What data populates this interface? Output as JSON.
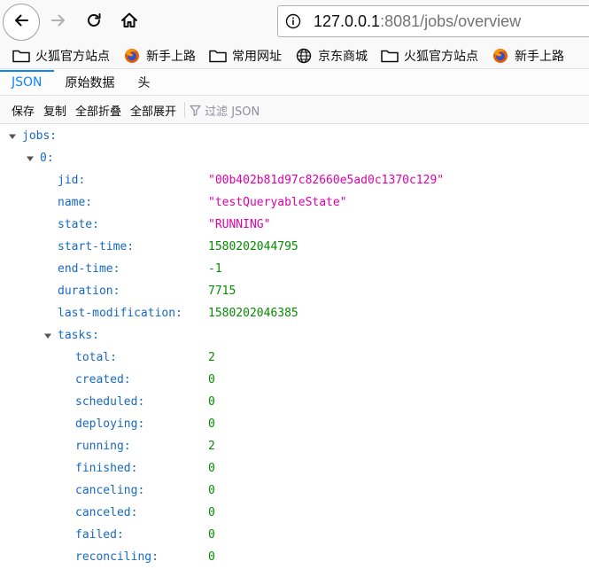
{
  "nav": {
    "url_host": "127.0.0.1",
    "url_rest": ":8081/jobs/overview"
  },
  "bookmarks": [
    {
      "label": "火狐官方站点",
      "icon": "folder-icon"
    },
    {
      "label": "新手上路",
      "icon": "firefox-icon"
    },
    {
      "label": "常用网址",
      "icon": "folder-icon"
    },
    {
      "label": "京东商城",
      "icon": "globe-icon"
    },
    {
      "label": "火狐官方站点",
      "icon": "folder-icon"
    },
    {
      "label": "新手上路",
      "icon": "firefox-icon"
    }
  ],
  "tabs": [
    "JSON",
    "原始数据",
    "头"
  ],
  "toolbar": {
    "save": "保存",
    "copy": "复制",
    "collapse_all": "全部折叠",
    "expand_all": "全部展开",
    "filter": "过滤 JSON"
  },
  "colors": {
    "accent": "#0a84ff",
    "key": "#1769c2",
    "string": "#dd00a9",
    "number": "#058b00"
  },
  "tree": {
    "root_key": "jobs:",
    "item_key": "0:",
    "fields": [
      {
        "key": "jid:",
        "value": "\"00b402b81d97c82660e5ad0c1370c129\"",
        "type": "str"
      },
      {
        "key": "name:",
        "value": "\"testQueryableState\"",
        "type": "str"
      },
      {
        "key": "state:",
        "value": "\"RUNNING\"",
        "type": "str"
      },
      {
        "key": "start-time:",
        "value": "1580202044795",
        "type": "num"
      },
      {
        "key": "end-time:",
        "value": "-1",
        "type": "num"
      },
      {
        "key": "duration:",
        "value": "7715",
        "type": "num"
      },
      {
        "key": "last-modification:",
        "value": "1580202046385",
        "type": "num"
      }
    ],
    "tasks_key": "tasks:",
    "tasks": [
      {
        "key": "total:",
        "value": "2"
      },
      {
        "key": "created:",
        "value": "0"
      },
      {
        "key": "scheduled:",
        "value": "0"
      },
      {
        "key": "deploying:",
        "value": "0"
      },
      {
        "key": "running:",
        "value": "2"
      },
      {
        "key": "finished:",
        "value": "0"
      },
      {
        "key": "canceling:",
        "value": "0"
      },
      {
        "key": "canceled:",
        "value": "0"
      },
      {
        "key": "failed:",
        "value": "0"
      },
      {
        "key": "reconciling:",
        "value": "0"
      }
    ]
  }
}
